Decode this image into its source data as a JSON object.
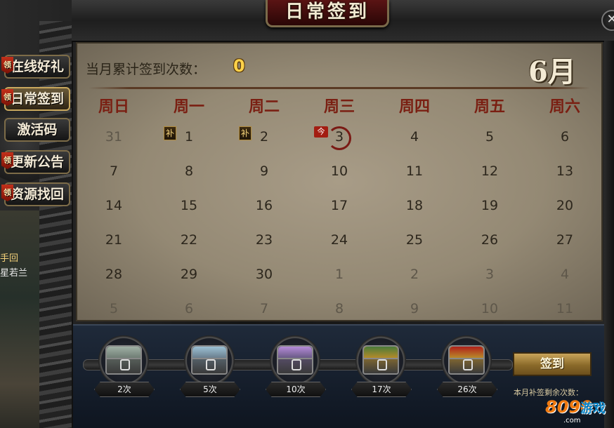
{
  "window": {
    "title": "日常签到",
    "close_icon": "close-icon"
  },
  "side_menu": {
    "items": [
      {
        "label": "在线好礼",
        "tag": "领",
        "active": false
      },
      {
        "label": "日常签到",
        "tag": "领",
        "active": true
      },
      {
        "label": "激活码",
        "tag": "",
        "active": false
      },
      {
        "label": "更新公告",
        "tag": "领",
        "active": false
      },
      {
        "label": "资源找回",
        "tag": "领",
        "active": false
      }
    ],
    "bg_label_a": "手回",
    "bg_label_b": "星若兰"
  },
  "header": {
    "count_label": "当月累计签到次数：",
    "count_value": "0",
    "month": "6月"
  },
  "calendar": {
    "weekdays": [
      "周日",
      "周一",
      "周二",
      "周三",
      "周四",
      "周五",
      "周六"
    ],
    "weeks": [
      [
        "31",
        "1",
        "2",
        "3",
        "4",
        "5",
        "6"
      ],
      [
        "7",
        "8",
        "9",
        "10",
        "11",
        "12",
        "13"
      ],
      [
        "14",
        "15",
        "16",
        "17",
        "18",
        "19",
        "20"
      ],
      [
        "21",
        "22",
        "23",
        "24",
        "25",
        "26",
        "27"
      ],
      [
        "28",
        "29",
        "30",
        "1",
        "2",
        "3",
        "4"
      ],
      [
        "5",
        "6",
        "7",
        "8",
        "9",
        "10",
        "11"
      ]
    ],
    "makeup_tag": "补",
    "today_tag": "今"
  },
  "rewards": {
    "chests": [
      {
        "label": "2次",
        "color": "#6f7d74",
        "accent": "#9fb0a4"
      },
      {
        "label": "5次",
        "color": "#6a7f8e",
        "accent": "#9cc0d4"
      },
      {
        "label": "10次",
        "color": "#6a5a86",
        "accent": "#b58ad8"
      },
      {
        "label": "17次",
        "color": "#b38a2a",
        "accent": "#4a7a3a"
      },
      {
        "label": "26次",
        "color": "#b88a2a",
        "accent": "#b0201a"
      }
    ],
    "sign_button": "签到",
    "makeup_remaining_label": "本月补签剩余次数："
  },
  "watermark": {
    "number": "8090",
    "text": "游戏",
    "domain": ".com"
  },
  "colors": {
    "weekday_red": "#7a1f12",
    "count_gold": "#ffd24a",
    "today_ring": "#7a1a14"
  }
}
